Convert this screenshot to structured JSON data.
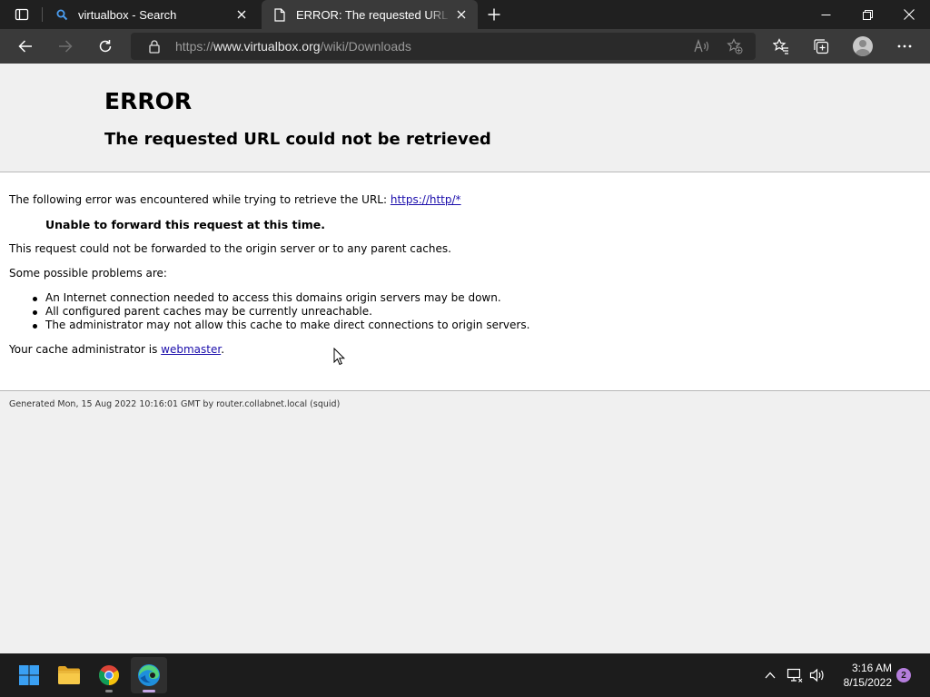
{
  "browser": {
    "tabs": [
      {
        "title": "virtualbox - Search",
        "icon": "search-icon",
        "active": false
      },
      {
        "title": "ERROR: The requested URL could not be retrieved",
        "icon": "page-icon",
        "active": true
      }
    ],
    "address": {
      "scheme": "https://",
      "host": "www.virtualbox.org",
      "path": "/wiki/Downloads"
    }
  },
  "page": {
    "title": "ERROR",
    "subtitle": "The requested URL could not be retrieved",
    "intro_text": "The following error was encountered while trying to retrieve the URL: ",
    "intro_link": "https://http/*",
    "bold_message": "Unable to forward this request at this time.",
    "detail_text": "This request could not be forwarded to the origin server or to any parent caches.",
    "problems_heading": "Some possible problems are:",
    "problems": [
      "An Internet connection needed to access this domains origin servers may be down.",
      "All configured parent caches may be currently unreachable.",
      "The administrator may not allow this cache to make direct connections to origin servers."
    ],
    "admin_text": "Your cache administrator is ",
    "admin_link": "webmaster",
    "admin_suffix": ".",
    "footer": "Generated Mon, 15 Aug 2022 10:16:01 GMT by router.collabnet.local (squid)"
  },
  "taskbar": {
    "apps": [
      "start-icon",
      "file-explorer-icon",
      "chrome-icon",
      "edge-icon"
    ],
    "time": "3:16 AM",
    "date": "8/15/2022",
    "notification_count": "2"
  },
  "colors": {
    "link": "#1a0dab",
    "edge_active_indicator": "#c6a7e8",
    "notification_badge": "#b57edc"
  }
}
